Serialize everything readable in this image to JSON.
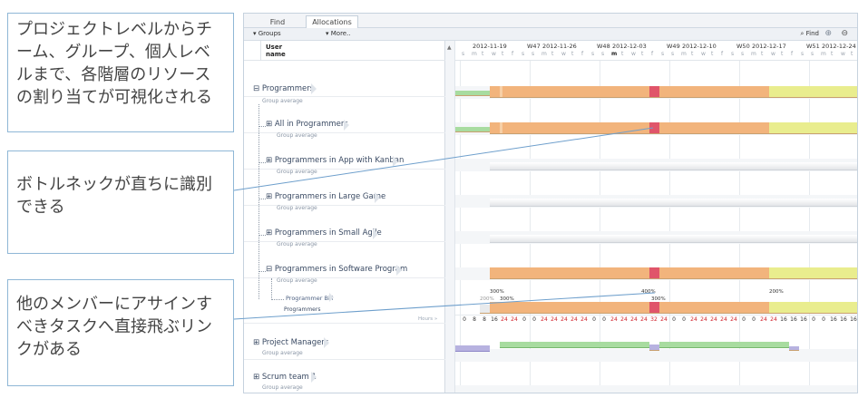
{
  "callouts": [
    "プロジェクトレベルからチーム、グループ、個人レベルまで、各階層のリソースの割り当てが可視化される",
    "ボトルネックが直ちに識別できる",
    "他のメンバーにアサインすべきタスクへ直接飛ぶリンクがある"
  ],
  "tabs": [
    "Find",
    "Allocations"
  ],
  "toolbar": {
    "groups_label": "Groups",
    "more_label": "More..",
    "find_label": "Find",
    "zoom_in_icon": "zoom-in-icon",
    "zoom_out_icon": "zoom-out-icon"
  },
  "tree": {
    "header_line1": "User",
    "header_line2": "name",
    "rows": [
      {
        "name": "Programmers",
        "sub": "Group average",
        "expander": "⊟"
      },
      {
        "name": "All in Programmers",
        "sub": "Group average",
        "expander": "⊞"
      },
      {
        "name": "Programmers in App with Kanban",
        "sub": "Group average",
        "expander": "⊞"
      },
      {
        "name": "Programmers in Large Game",
        "sub": "Group average",
        "expander": "⊞"
      },
      {
        "name": "Programmers in Small Agile",
        "sub": "Group average",
        "expander": "⊞"
      },
      {
        "name": "Programmers in Software Program",
        "sub": "Group average",
        "expander": "⊟"
      },
      {
        "name": "Programmer Bill",
        "sub": "Programmers",
        "expander": ""
      },
      {
        "name": "Project Managers",
        "sub": "Group average",
        "expander": "⊞"
      },
      {
        "name": "Scrum team 1",
        "sub": "Group average",
        "expander": "⊞"
      }
    ],
    "hours_label": "Hours »"
  },
  "timeline": {
    "dates": [
      "2012-11-19",
      "2012-11-26",
      "2012-12-03",
      "2012-12-10",
      "2012-12-17",
      "2012-12-24"
    ],
    "weeks": [
      "W47",
      "W48",
      "W49",
      "W50",
      "W51"
    ],
    "day_letters": [
      "s",
      "m",
      "t",
      "w",
      "t",
      "f",
      "s"
    ]
  },
  "bill": {
    "percent_labels": [
      "200%",
      "300%",
      "400%",
      "300%",
      "200%"
    ],
    "hours": [
      "0",
      "8",
      "8",
      "16",
      "24",
      "24",
      "0",
      "0",
      "24",
      "24",
      "24",
      "24",
      "24",
      "0",
      "0",
      "24",
      "24",
      "24",
      "24",
      "32",
      "24",
      "0",
      "0",
      "24",
      "24",
      "24",
      "24",
      "24",
      "0",
      "0",
      "24",
      "24",
      "16",
      "16",
      "16",
      "0",
      "0",
      "16",
      "16",
      "16",
      "16"
    ]
  },
  "colors": {
    "orange": "#f2b47c",
    "yellow": "#e9ed8e",
    "green": "#a8dca0",
    "purple": "#b7b2e0",
    "peak": "#e0556a",
    "border": "#8fb7d6"
  }
}
